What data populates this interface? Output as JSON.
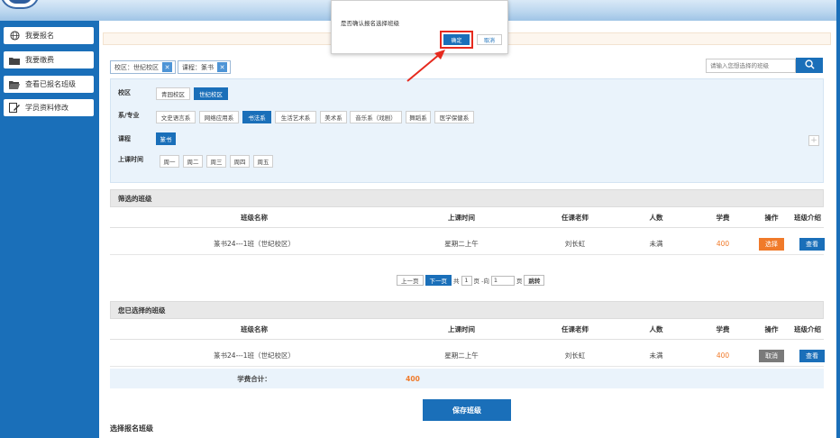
{
  "sidebar": {
    "items": [
      {
        "label": "我要报名",
        "icon": "globe-icon"
      },
      {
        "label": "我要缴费",
        "icon": "folder-icon"
      },
      {
        "label": "查看已报名班级",
        "icon": "folder-open-icon"
      },
      {
        "label": "学员资料修改",
        "icon": "edit-icon"
      }
    ]
  },
  "filters": {
    "tags": [
      {
        "label": "校区：世纪校区"
      },
      {
        "label": "课程：篆书"
      }
    ],
    "search_placeholder": "请输入您想选择的班级"
  },
  "filter_panel": {
    "campus_label": "校区",
    "campus_options": [
      "青园校区",
      "世纪校区"
    ],
    "campus_selected": "世纪校区",
    "dept_label": "系/专业",
    "dept_options": [
      "文史语言系",
      "网络应用系",
      "书法系",
      "生活艺术系",
      "美术系",
      "音乐系（戏剧）",
      "舞蹈系",
      "医学保健系"
    ],
    "dept_selected": "书法系",
    "course_label": "课程",
    "course_options": [
      "篆书"
    ],
    "course_selected": "篆书",
    "time_label": "上课时间",
    "time_options": [
      "周一",
      "周二",
      "周三",
      "周四",
      "周五"
    ]
  },
  "filtered_table": {
    "title": "筛选的班级",
    "headers": [
      "班级名称",
      "上课时间",
      "任课老师",
      "人数",
      "学费",
      "操作",
      "班级介绍"
    ],
    "rows": [
      {
        "name": "篆书24---1班（世纪校区）",
        "time": "星期二上午",
        "teacher": "刘长虹",
        "count": "未满",
        "fee": "400",
        "action": "选择",
        "intro": "查看"
      }
    ]
  },
  "pager": {
    "prev": "上一页",
    "next": "下一页",
    "total_prefix": "共",
    "total": "1",
    "total_suffix": "页 -向",
    "goto_value": "1",
    "goto_suffix": "页",
    "jump": "跳转"
  },
  "selected_table": {
    "title": "您已选择的班级",
    "headers": [
      "班级名称",
      "上课时间",
      "任课老师",
      "人数",
      "学费",
      "操作",
      "班级介绍"
    ],
    "rows": [
      {
        "name": "篆书24---1班（世纪校区）",
        "time": "星期二上午",
        "teacher": "刘长虹",
        "count": "未满",
        "fee": "400",
        "action": "取消",
        "intro": "查看"
      }
    ],
    "sum_label": "学费合计：",
    "sum_value": "400"
  },
  "save_button": "保存班级",
  "bottom_title": "选择报名班级",
  "dialog": {
    "message": "是否确认报名选择班级",
    "ok": "确定",
    "cancel": "取消"
  },
  "colors": {
    "primary": "#1a6fb9",
    "accent_orange": "#f07a2a",
    "highlight_red": "#e62a1e"
  }
}
